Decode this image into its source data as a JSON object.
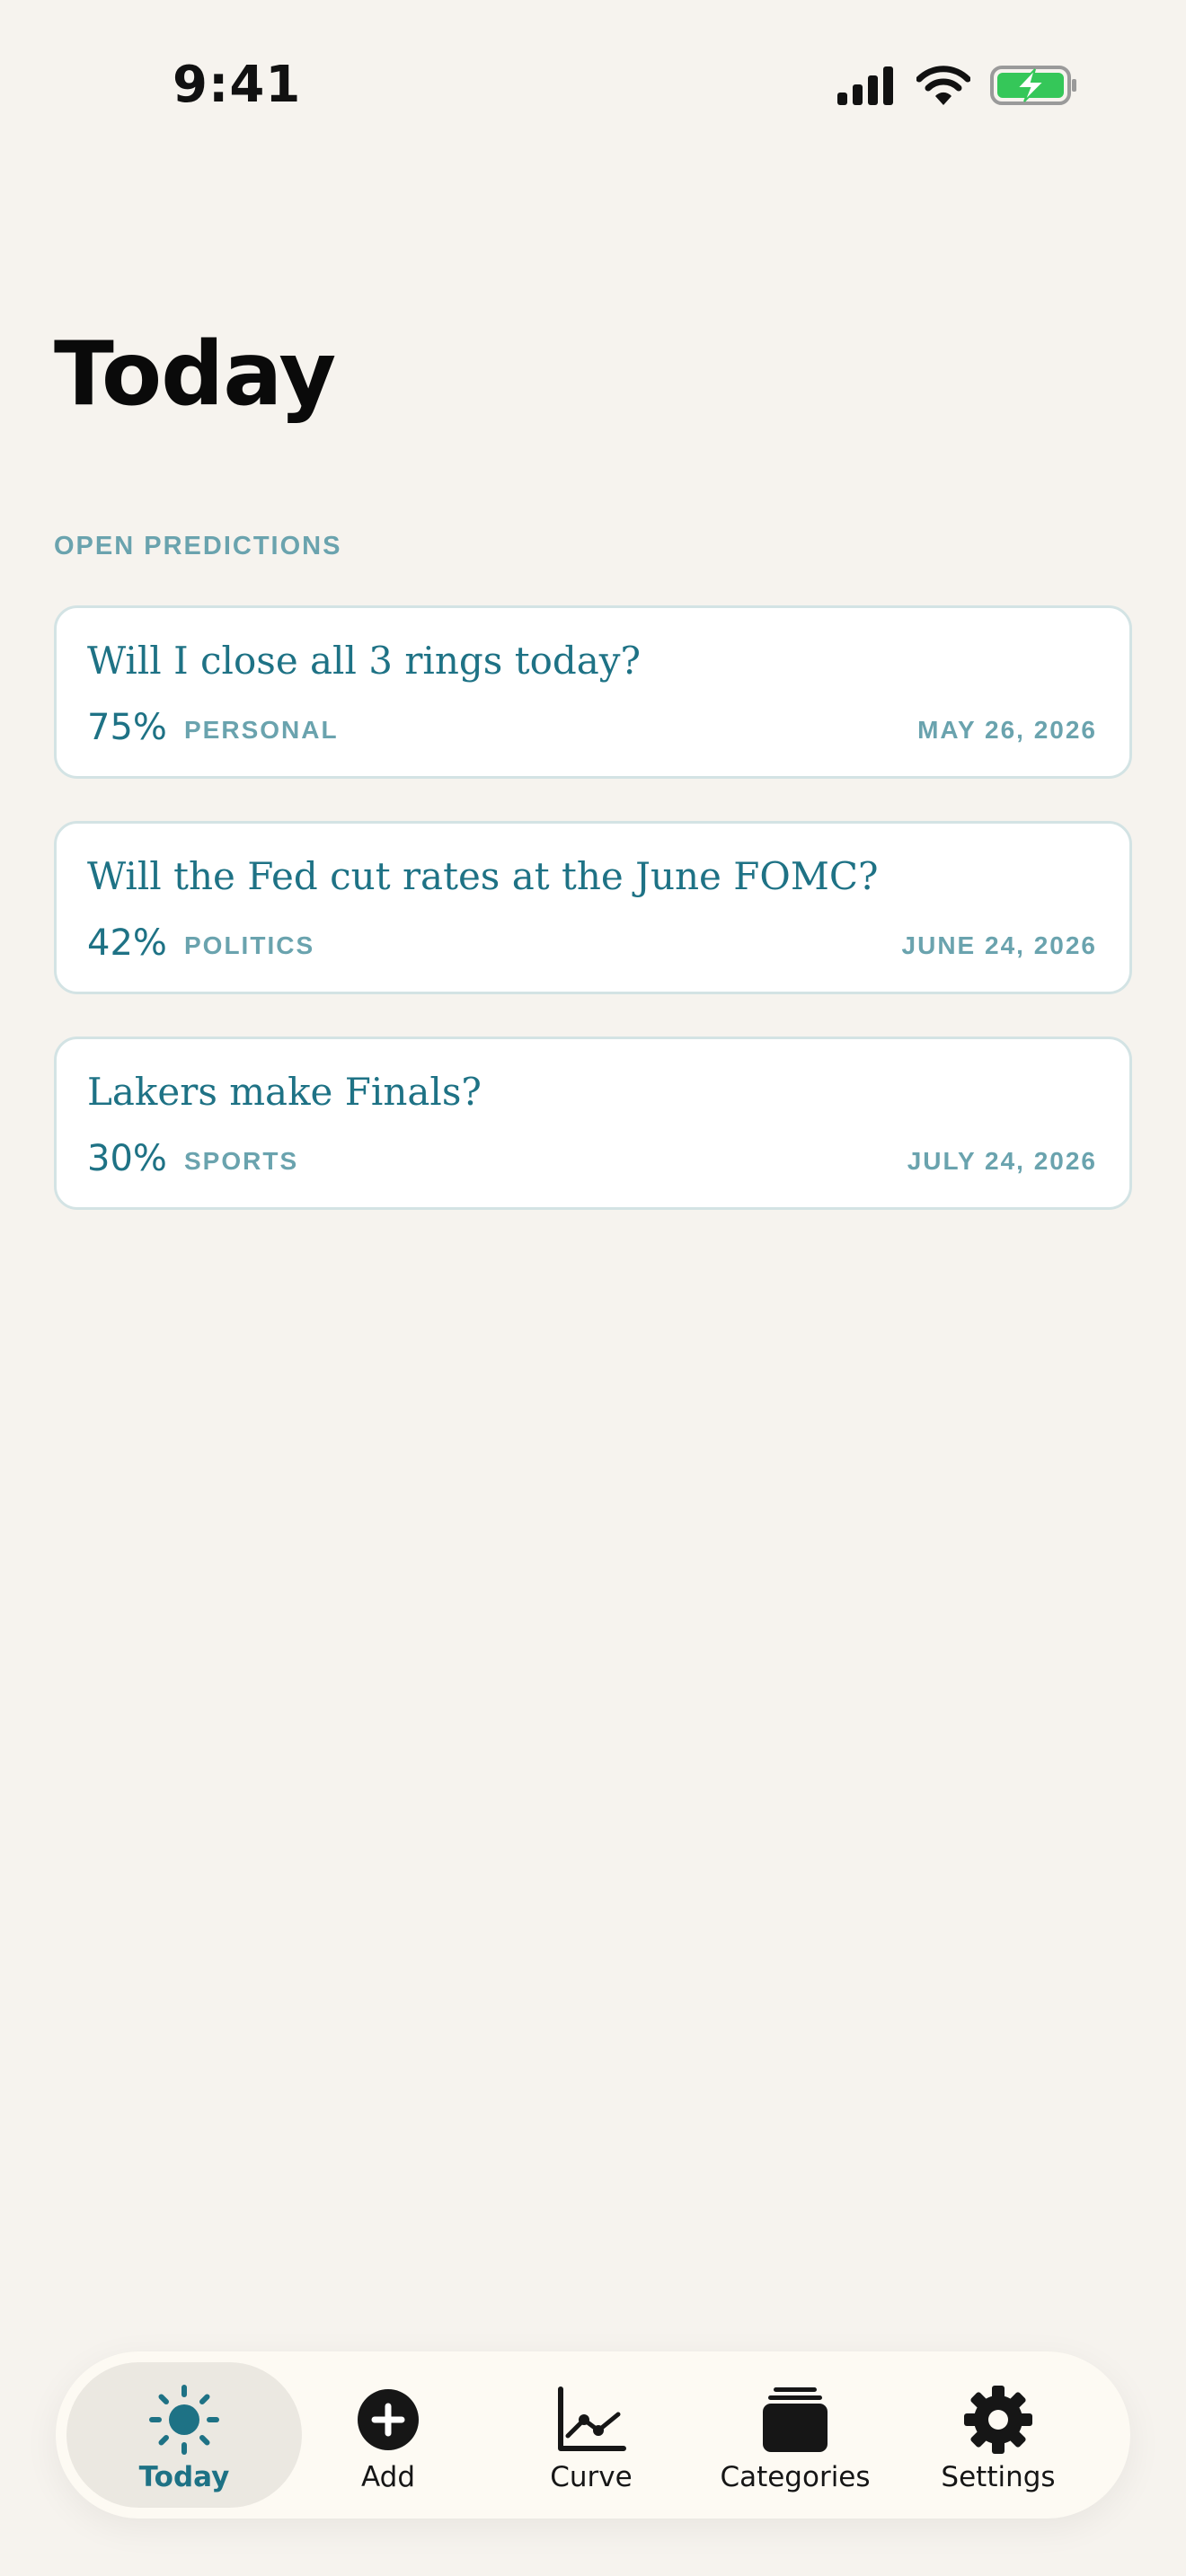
{
  "status_bar": {
    "time": "9:41"
  },
  "page": {
    "title": "Today",
    "section_label": "OPEN PREDICTIONS"
  },
  "predictions": [
    {
      "question": "Will I close all 3 rings today?",
      "probability": "75%",
      "category": "PERSONAL",
      "date": "MAY 26, 2026"
    },
    {
      "question": "Will the Fed cut rates at the June FOMC?",
      "probability": "42%",
      "category": "POLITICS",
      "date": "JUNE 24, 2026"
    },
    {
      "question": "Lakers make Finals?",
      "probability": "30%",
      "category": "SPORTS",
      "date": "JULY 24, 2026"
    }
  ],
  "tab_bar": {
    "active": "Today",
    "tabs": [
      {
        "label": "Today",
        "icon": "sun-icon"
      },
      {
        "label": "Add",
        "icon": "plus-circle-icon"
      },
      {
        "label": "Curve",
        "icon": "chart-line-icon"
      },
      {
        "label": "Categories",
        "icon": "stack-icon"
      },
      {
        "label": "Settings",
        "icon": "gear-icon"
      }
    ]
  },
  "colors": {
    "background": "#f6f3ee",
    "accent": "#1e7285",
    "muted_accent": "#6aa3ae",
    "card_border": "#d3e3e4",
    "battery": "#35c759"
  }
}
